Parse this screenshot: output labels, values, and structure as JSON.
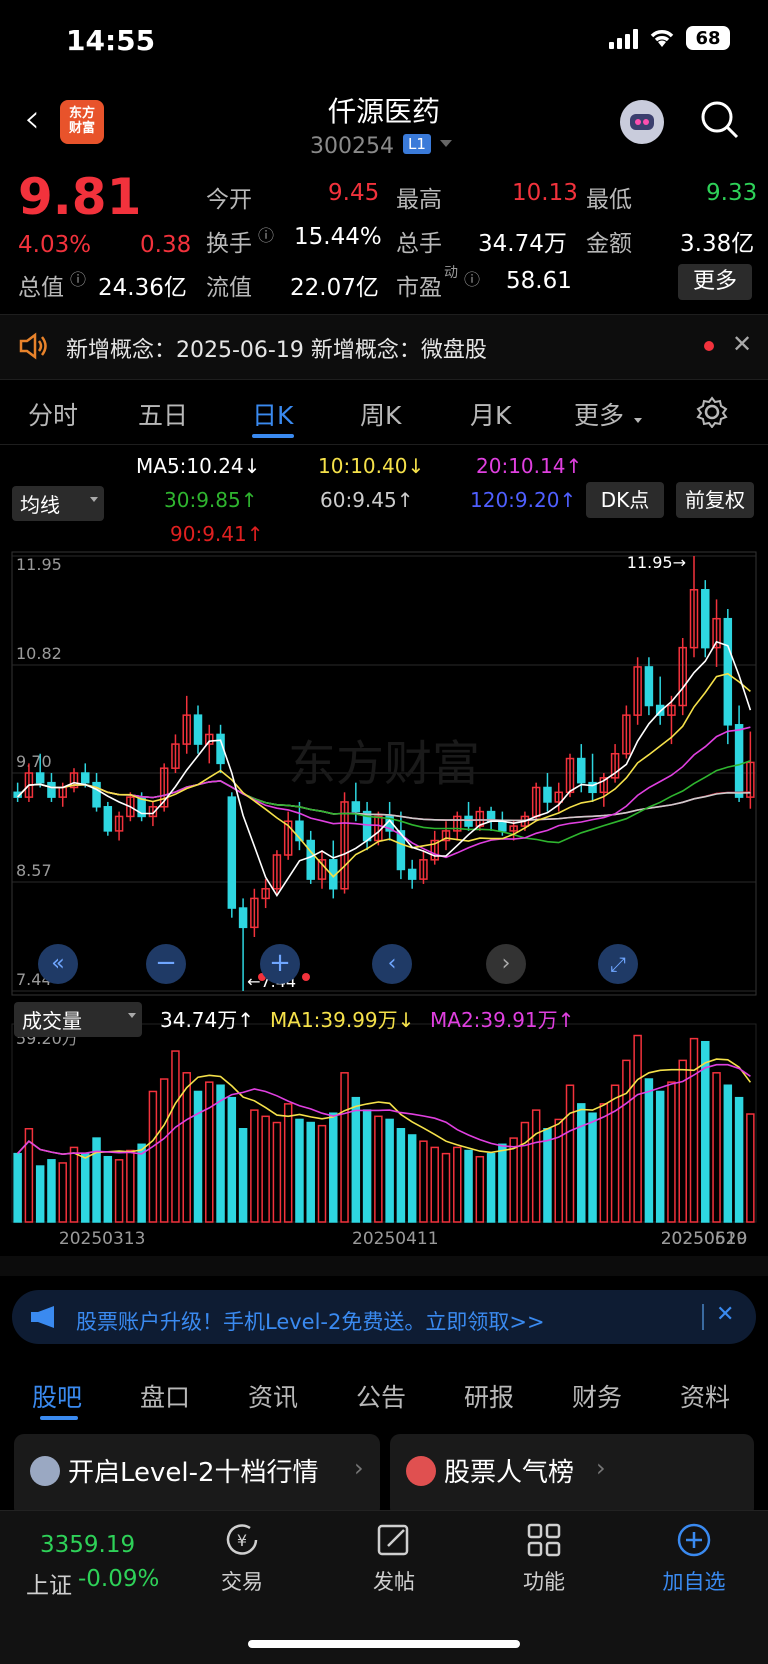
{
  "status": {
    "time": "14:55",
    "battery": "68"
  },
  "header": {
    "logo_top": "东方",
    "logo_bottom": "财富",
    "title": "仟源医药",
    "code": "300254",
    "level": "L1"
  },
  "quote": {
    "price": "9.81",
    "change_pct": "4.03%",
    "change": "0.38",
    "open_label": "今开",
    "open": "9.45",
    "high_label": "最高",
    "high": "10.13",
    "low_label": "最低",
    "low": "9.33",
    "turnover_label": "换手",
    "turnover": "15.44%",
    "volume_label": "总手",
    "volume": "34.74万",
    "amount_label": "金额",
    "amount": "3.38亿",
    "mktcap_label": "总值",
    "mktcap": "24.36亿",
    "float_label": "流值",
    "float": "22.07亿",
    "pe_label": "市盈",
    "pe_sup": "动",
    "pe": "58.61",
    "more": "更多"
  },
  "notice": {
    "text": "新增概念：2025-06-19 新增概念：微盘股"
  },
  "tabs": [
    "分时",
    "五日",
    "日K",
    "周K",
    "月K",
    "更多"
  ],
  "ma": {
    "selector": "均线",
    "ma5": "MA5:10.24↓",
    "ma10": "10:10.40↓",
    "ma20": "20:10.14↑",
    "ma30": "30:9.85↑",
    "ma60": "60:9.45↑",
    "ma120": "120:9.20↑",
    "ma90": "90:9.41↑",
    "dk": "DK点",
    "fq": "前复权"
  },
  "vol": {
    "selector": "成交量",
    "value": "34.74万↑",
    "ma1": "MA1:39.99万↓",
    "ma2": "MA2:39.91万↑"
  },
  "colors": {
    "up": "#f2323c",
    "down": "#2ed6e0",
    "accent": "#3a8af0",
    "ma5": "#ffffff",
    "ma10": "#f5e14a",
    "ma20": "#e040e0",
    "ma30": "#2fb52f",
    "ma60": "#cccccc",
    "ma120": "#3f4fd8",
    "ma90": "#e02020"
  },
  "chart_data": {
    "type": "candlestick",
    "y_ticks": [
      "11.95",
      "10.82",
      "9.70",
      "8.57",
      "7.44"
    ],
    "ylim": [
      7.44,
      11.95
    ],
    "max_label": "11.95",
    "min_label": "7.44",
    "x_ticks": [
      "20250313",
      "20250411",
      "20250519",
      "20250620"
    ],
    "candles": [
      [
        9.5,
        9.6,
        9.4,
        9.45
      ],
      [
        9.45,
        9.8,
        9.4,
        9.7
      ],
      [
        9.7,
        9.9,
        9.55,
        9.6
      ],
      [
        9.6,
        9.7,
        9.4,
        9.45
      ],
      [
        9.45,
        9.6,
        9.35,
        9.55
      ],
      [
        9.55,
        9.75,
        9.5,
        9.7
      ],
      [
        9.7,
        9.8,
        9.55,
        9.6
      ],
      [
        9.6,
        9.7,
        9.3,
        9.35
      ],
      [
        9.35,
        9.4,
        9.05,
        9.1
      ],
      [
        9.1,
        9.3,
        9.0,
        9.25
      ],
      [
        9.25,
        9.5,
        9.2,
        9.45
      ],
      [
        9.45,
        9.5,
        9.2,
        9.25
      ],
      [
        9.25,
        9.4,
        9.15,
        9.35
      ],
      [
        9.35,
        9.8,
        9.3,
        9.75
      ],
      [
        9.75,
        10.1,
        9.7,
        10.0
      ],
      [
        10.0,
        10.5,
        9.9,
        10.3
      ],
      [
        10.3,
        10.4,
        9.9,
        10.0
      ],
      [
        10.0,
        10.2,
        9.8,
        10.1
      ],
      [
        10.1,
        10.2,
        9.7,
        9.8
      ],
      [
        9.45,
        9.5,
        8.2,
        8.3
      ],
      [
        8.3,
        8.4,
        7.44,
        8.1
      ],
      [
        8.1,
        8.5,
        8.0,
        8.4
      ],
      [
        8.4,
        8.6,
        8.3,
        8.5
      ],
      [
        8.5,
        8.9,
        8.45,
        8.85
      ],
      [
        8.85,
        9.3,
        8.8,
        9.2
      ],
      [
        9.2,
        9.4,
        8.9,
        9.0
      ],
      [
        9.0,
        9.1,
        8.55,
        8.6
      ],
      [
        8.6,
        8.9,
        8.5,
        8.8
      ],
      [
        8.8,
        9.0,
        8.4,
        8.5
      ],
      [
        8.5,
        9.5,
        8.45,
        9.4
      ],
      [
        9.4,
        9.6,
        9.2,
        9.3
      ],
      [
        9.3,
        9.4,
        8.9,
        9.0
      ],
      [
        9.0,
        9.3,
        8.95,
        9.25
      ],
      [
        9.25,
        9.4,
        9.0,
        9.1
      ],
      [
        9.1,
        9.3,
        8.6,
        8.7
      ],
      [
        8.7,
        8.8,
        8.5,
        8.6
      ],
      [
        8.6,
        8.9,
        8.55,
        8.8
      ],
      [
        8.8,
        9.1,
        8.75,
        9.0
      ],
      [
        9.0,
        9.2,
        8.9,
        9.1
      ],
      [
        9.1,
        9.3,
        9.0,
        9.25
      ],
      [
        9.25,
        9.4,
        9.1,
        9.15
      ],
      [
        9.15,
        9.35,
        9.1,
        9.3
      ],
      [
        9.3,
        9.35,
        9.1,
        9.2
      ],
      [
        9.2,
        9.3,
        9.05,
        9.1
      ],
      [
        9.1,
        9.2,
        9.0,
        9.15
      ],
      [
        9.15,
        9.3,
        9.1,
        9.25
      ],
      [
        9.25,
        9.6,
        9.2,
        9.55
      ],
      [
        9.55,
        9.7,
        9.3,
        9.4
      ],
      [
        9.4,
        9.6,
        9.3,
        9.5
      ],
      [
        9.5,
        9.9,
        9.45,
        9.85
      ],
      [
        9.85,
        10.0,
        9.5,
        9.6
      ],
      [
        9.6,
        9.9,
        9.4,
        9.5
      ],
      [
        9.5,
        9.7,
        9.35,
        9.65
      ],
      [
        9.65,
        10.0,
        9.6,
        9.9
      ],
      [
        9.9,
        10.4,
        9.85,
        10.3
      ],
      [
        10.3,
        10.9,
        10.2,
        10.8
      ],
      [
        10.8,
        10.9,
        10.3,
        10.4
      ],
      [
        10.4,
        10.7,
        10.2,
        10.3
      ],
      [
        10.3,
        10.5,
        10.0,
        10.4
      ],
      [
        10.4,
        11.1,
        10.3,
        11.0
      ],
      [
        11.0,
        11.95,
        10.9,
        11.6
      ],
      [
        11.6,
        11.7,
        10.9,
        11.0
      ],
      [
        11.0,
        11.5,
        10.8,
        11.3
      ],
      [
        11.3,
        11.4,
        10.0,
        10.2
      ],
      [
        10.2,
        10.4,
        9.4,
        9.45
      ],
      [
        9.45,
        10.13,
        9.33,
        9.81
      ]
    ],
    "volume_max_label": "59.20万",
    "volume": [
      22,
      30,
      18,
      20,
      19,
      24,
      22,
      27,
      21,
      20,
      23,
      25,
      42,
      46,
      55,
      48,
      42,
      45,
      44,
      40,
      30,
      36,
      34,
      32,
      38,
      33,
      32,
      31,
      35,
      48,
      40,
      36,
      34,
      33,
      30,
      28,
      26,
      24,
      22,
      24,
      23,
      21,
      22,
      25,
      27,
      32,
      36,
      30,
      33,
      44,
      38,
      35,
      38,
      44,
      52,
      60,
      46,
      42,
      45,
      52,
      59,
      58,
      48,
      44,
      40,
      34.74
    ]
  },
  "ad": {
    "text": "股票账户升级！手机Level-2免费送。立即领取>>"
  },
  "bottom_tabs": [
    "股吧",
    "盘口",
    "资讯",
    "公告",
    "研报",
    "财务",
    "资料"
  ],
  "cards": [
    {
      "title": "开启Level-2十档行情"
    },
    {
      "title": "股票人气榜"
    }
  ],
  "nav": {
    "index_value": "3359.19",
    "index_name": "上证",
    "index_change": "-0.09%",
    "trade": "交易",
    "post": "发帖",
    "func": "功能",
    "add": "加自选"
  }
}
